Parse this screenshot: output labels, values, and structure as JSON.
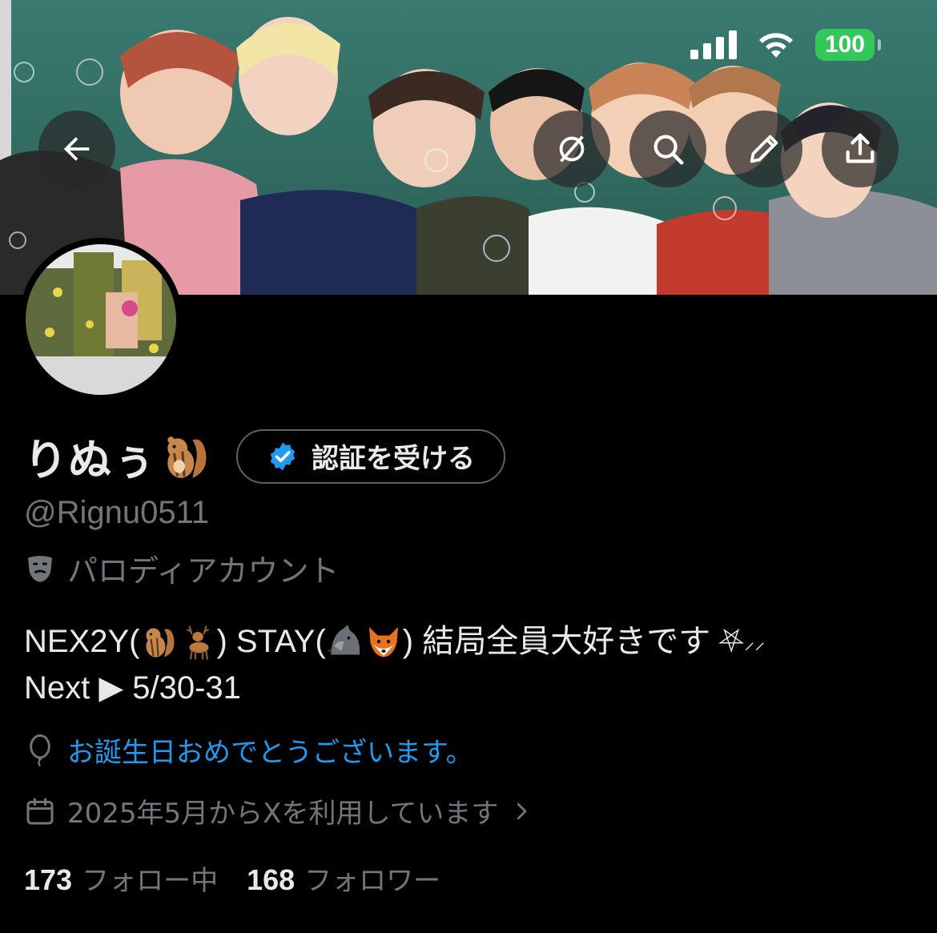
{
  "status_bar": {
    "battery": "100",
    "signal_icon": "cellular-signal-icon",
    "wifi_icon": "wifi-icon"
  },
  "header_buttons": {
    "back_icon": "arrow-left-icon",
    "grok_icon": "grok-icon",
    "search_icon": "search-icon",
    "edit_icon": "pencil-icon",
    "share_icon": "share-icon"
  },
  "profile": {
    "display_name": "りぬぅ",
    "name_emoji": "chipmunk",
    "verify_label": "認証を受ける",
    "handle": "@Rignu0511",
    "parody_label": "パロディアカウント",
    "bio_line1_a": "NEX2Y(",
    "bio_line1_b": ") STAY(",
    "bio_line1_c": ") 結局全員大好きです",
    "bio_line1_d": "⛧",
    "bio_line1_e": "⸝⸝",
    "bio_line2": "Next ▶︎ 5/30-31",
    "birthday": "お誕生日おめでとうございます。",
    "joined": "2025年5月からXを利用しています",
    "following_count": "173",
    "following_label": "フォロー中",
    "followers_count": "168",
    "followers_label": "フォロワー"
  },
  "colors": {
    "accent": "#1d9bf0",
    "muted": "#71767b",
    "battery": "#34c759"
  }
}
